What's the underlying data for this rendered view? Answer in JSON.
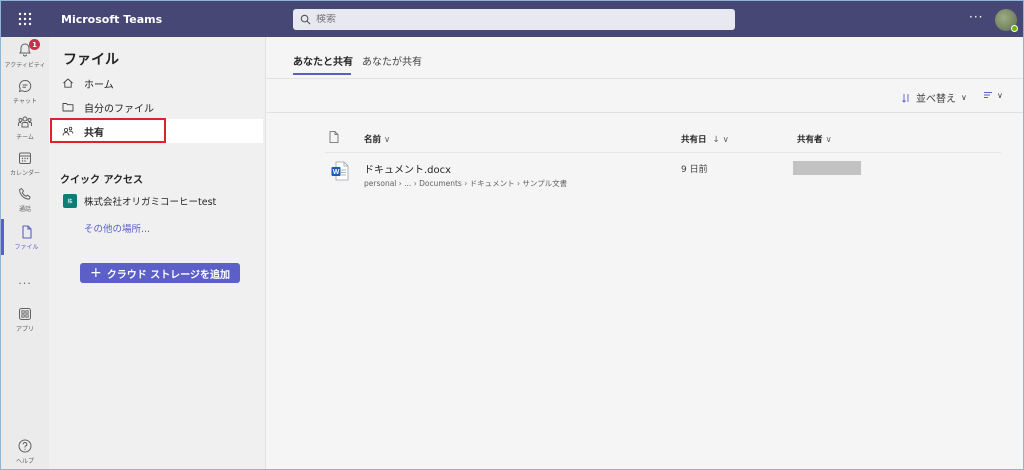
{
  "app": {
    "title": "Microsoft Teams"
  },
  "search": {
    "placeholder": "検索"
  },
  "topbar": {
    "more_label": "···"
  },
  "rail": {
    "items": [
      {
        "label": "アクティビティ",
        "icon": "bell-icon",
        "badge": "1"
      },
      {
        "label": "チャット",
        "icon": "chat-icon"
      },
      {
        "label": "チーム",
        "icon": "teams-icon"
      },
      {
        "label": "カレンダー",
        "icon": "calendar-icon"
      },
      {
        "label": "通話",
        "icon": "phone-icon"
      },
      {
        "label": "ファイル",
        "icon": "file-icon",
        "active": true
      },
      {
        "label": "···",
        "icon": "more-icon"
      },
      {
        "label": "アプリ",
        "icon": "apps-icon"
      },
      {
        "label": "ヘルプ",
        "icon": "help-icon"
      }
    ]
  },
  "files_pane": {
    "title": "ファイル",
    "nav": [
      {
        "label": "ホーム",
        "icon": "home-icon"
      },
      {
        "label": "自分のファイル",
        "icon": "folder-icon"
      },
      {
        "label": "共有",
        "icon": "people-icon",
        "selected": true
      }
    ],
    "quick_access": {
      "title": "クイック アクセス",
      "items": [
        {
          "label": "株式会社オリガミコーヒーtest",
          "logo_text": "株"
        }
      ],
      "more_link": "その他の場所..."
    },
    "add_storage_button": "クラウド ストレージを追加"
  },
  "main": {
    "tabs": [
      {
        "label": "あなたと共有",
        "active": true
      },
      {
        "label": "あなたが共有"
      }
    ],
    "toolbar": {
      "sort_label": "並べ替え"
    },
    "columns": {
      "name": "名前",
      "shared_date": "共有日",
      "sort_arrow": "↓",
      "shared_by": "共有者"
    },
    "rows": [
      {
        "name": "ドキュメント.docx",
        "path": "personal › ... › Documents › ドキュメント › サンプル文書",
        "shared_date": "9 日前",
        "file_type_icon": "word-icon"
      }
    ]
  },
  "colors": {
    "accent": "#5b5fc7",
    "topbar": "#464775",
    "highlight": "#e0202a",
    "word": "#185abd"
  }
}
